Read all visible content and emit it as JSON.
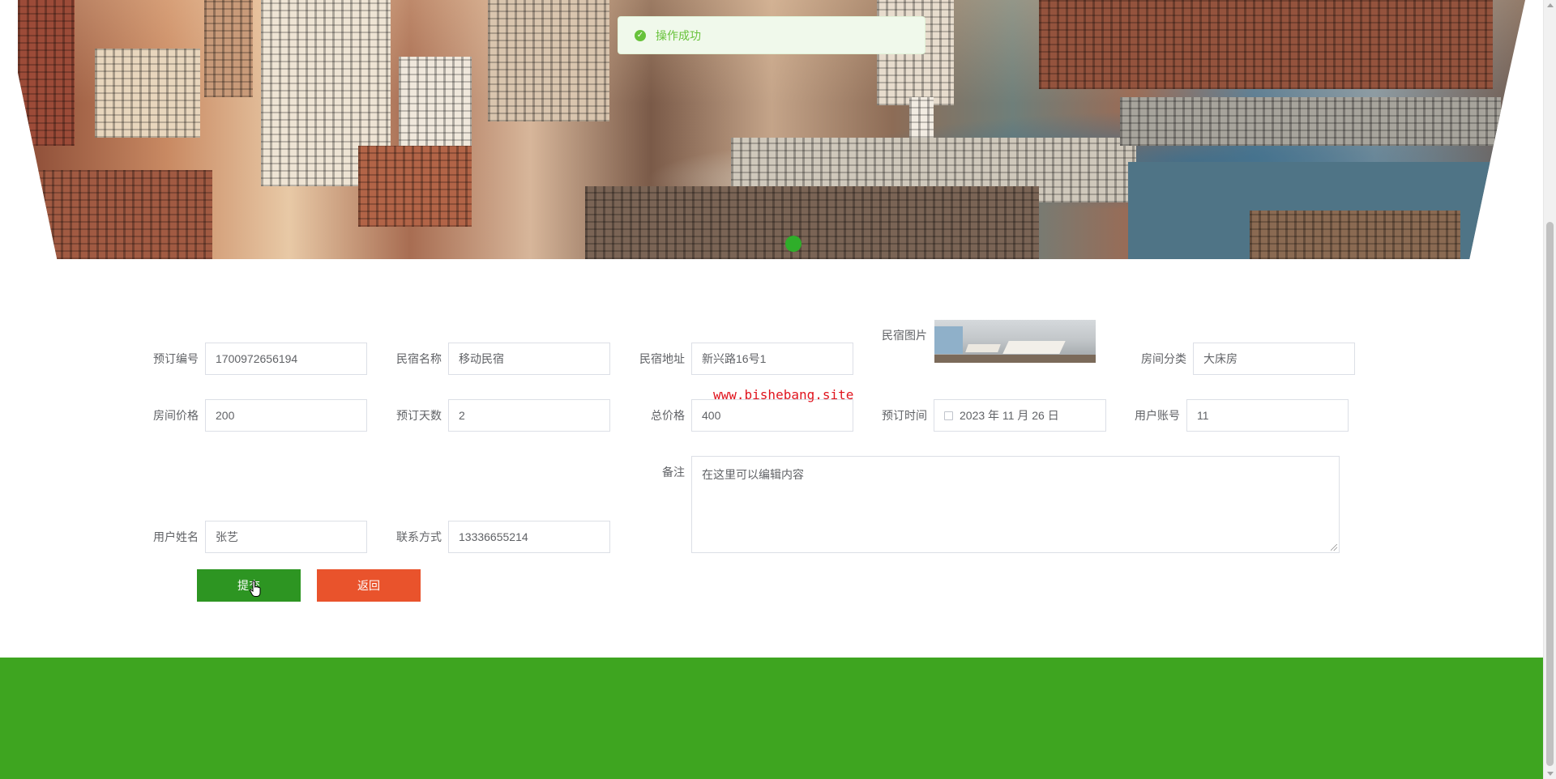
{
  "toast": {
    "icon": "check-circle-icon",
    "message": "操作成功"
  },
  "banner": {
    "active_dot_color": "#2fae2a"
  },
  "form": {
    "order_no": {
      "label": "预订编号",
      "value": "1700972656194"
    },
    "homestay_name": {
      "label": "民宿名称",
      "value": "移动民宿"
    },
    "homestay_address": {
      "label": "民宿地址",
      "value": "新兴路16号1"
    },
    "homestay_image": {
      "label": "民宿图片"
    },
    "room_category": {
      "label": "房间分类",
      "value": "大床房"
    },
    "room_price": {
      "label": "房间价格",
      "value": "200"
    },
    "booking_days": {
      "label": "预订天数",
      "value": "2"
    },
    "total_price": {
      "label": "总价格",
      "value": "400"
    },
    "booking_time": {
      "label": "预订时间",
      "value": "2023 年 11 月 26 日",
      "icon": "calendar-icon"
    },
    "user_account": {
      "label": "用户账号",
      "value": "11"
    },
    "remark": {
      "label": "备注",
      "value": "在这里可以编辑内容"
    },
    "user_name": {
      "label": "用户姓名",
      "value": "张艺"
    },
    "contact": {
      "label": "联系方式",
      "value": "13336655214"
    }
  },
  "buttons": {
    "submit_label": "提交",
    "back_label": "返回"
  },
  "watermark": "www.bishebang.site",
  "colors": {
    "primary_green": "#2d9522",
    "back_red": "#e9532c",
    "footer_green": "#3ea520",
    "success": "#67c23a"
  }
}
